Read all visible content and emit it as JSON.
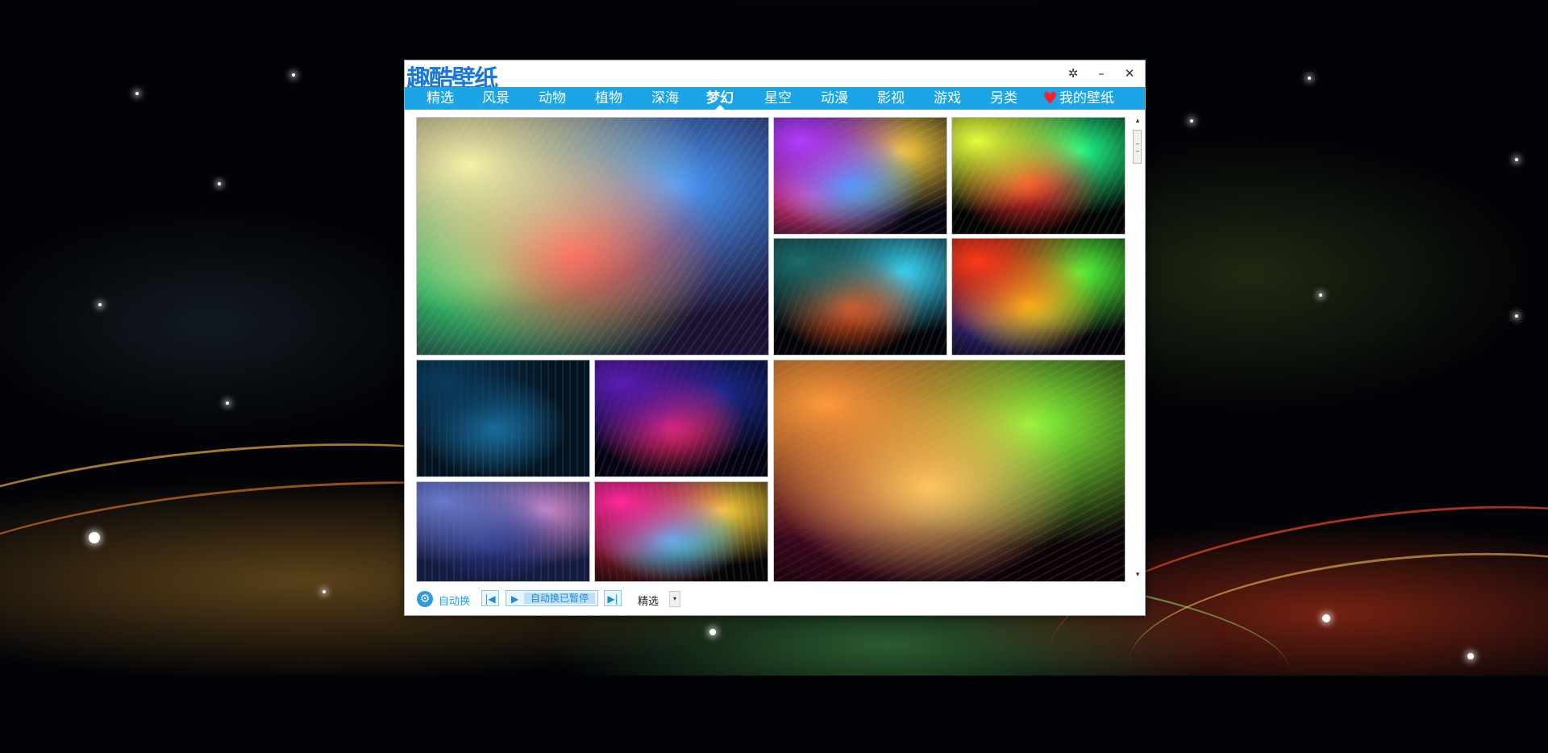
{
  "app": {
    "logo_text": "趣酷壁纸",
    "window_buttons": {
      "settings": "✲",
      "minimize": "–",
      "close": "✕"
    }
  },
  "nav": {
    "items": [
      {
        "label": "精选",
        "active": false
      },
      {
        "label": "风景",
        "active": false
      },
      {
        "label": "动物",
        "active": false
      },
      {
        "label": "植物",
        "active": false
      },
      {
        "label": "深海",
        "active": false
      },
      {
        "label": "梦幻",
        "active": true
      },
      {
        "label": "星空",
        "active": false
      },
      {
        "label": "动漫",
        "active": false
      },
      {
        "label": "影视",
        "active": false
      },
      {
        "label": "游戏",
        "active": false
      },
      {
        "label": "另类",
        "active": false
      }
    ],
    "my_wallpapers": "我的壁纸",
    "heart_icon": "♥"
  },
  "gallery": {
    "thumbnails": [
      {
        "name": "rainbow-streaks",
        "colors": [
          "#f6f2a8",
          "#ff4a4a",
          "#4a9cff",
          "#3cff7c",
          "#1b1030"
        ]
      },
      {
        "name": "neon-vertical-lines",
        "colors": [
          "#b43cff",
          "#3cb4ff",
          "#ffd23c",
          "#ff3c8c",
          "#050510"
        ]
      },
      {
        "name": "glowing-ribbon",
        "colors": [
          "#e6ff3c",
          "#ff2d2d",
          "#20ff8a",
          "#020402"
        ]
      },
      {
        "name": "colorful-wave",
        "colors": [
          "#1d6a6a",
          "#ff5a1f",
          "#3cdcff",
          "#020306"
        ]
      },
      {
        "name": "particle-burst",
        "colors": [
          "#ff3a1a",
          "#ffd21a",
          "#54ff3c",
          "#3a2a8a",
          "#030308"
        ]
      },
      {
        "name": "blue-bokeh",
        "colors": [
          "#0a3a5c",
          "#1d7ab0",
          "#031320"
        ]
      },
      {
        "name": "purple-galaxy",
        "colors": [
          "#5a1cb4",
          "#ff2a6c",
          "#1a2a8a",
          "#030312"
        ]
      },
      {
        "name": "orange-light-trails",
        "colors": [
          "#ff9a3c",
          "#ffd26c",
          "#8aff3c",
          "#5a0a2a",
          "#0a0206"
        ]
      },
      {
        "name": "blue-swirl",
        "colors": [
          "#6a7acc",
          "#2a3a8a",
          "#d08acc",
          "#141a40"
        ]
      },
      {
        "name": "neon-bars",
        "colors": [
          "#ff2a9c",
          "#3cd2ff",
          "#ffd23c",
          "#8a1a2a",
          "#050505"
        ]
      }
    ]
  },
  "controls": {
    "auto_change_label": "自动换",
    "gear_icon": "⚙",
    "prev_icon": "|◀",
    "play_icon": "▶",
    "status_text": "自动换已暂停",
    "next_icon": "▶|",
    "category_select": "精选",
    "select_arrow": "▾"
  },
  "scrollbar": {
    "up": "▴",
    "down": "▾"
  }
}
